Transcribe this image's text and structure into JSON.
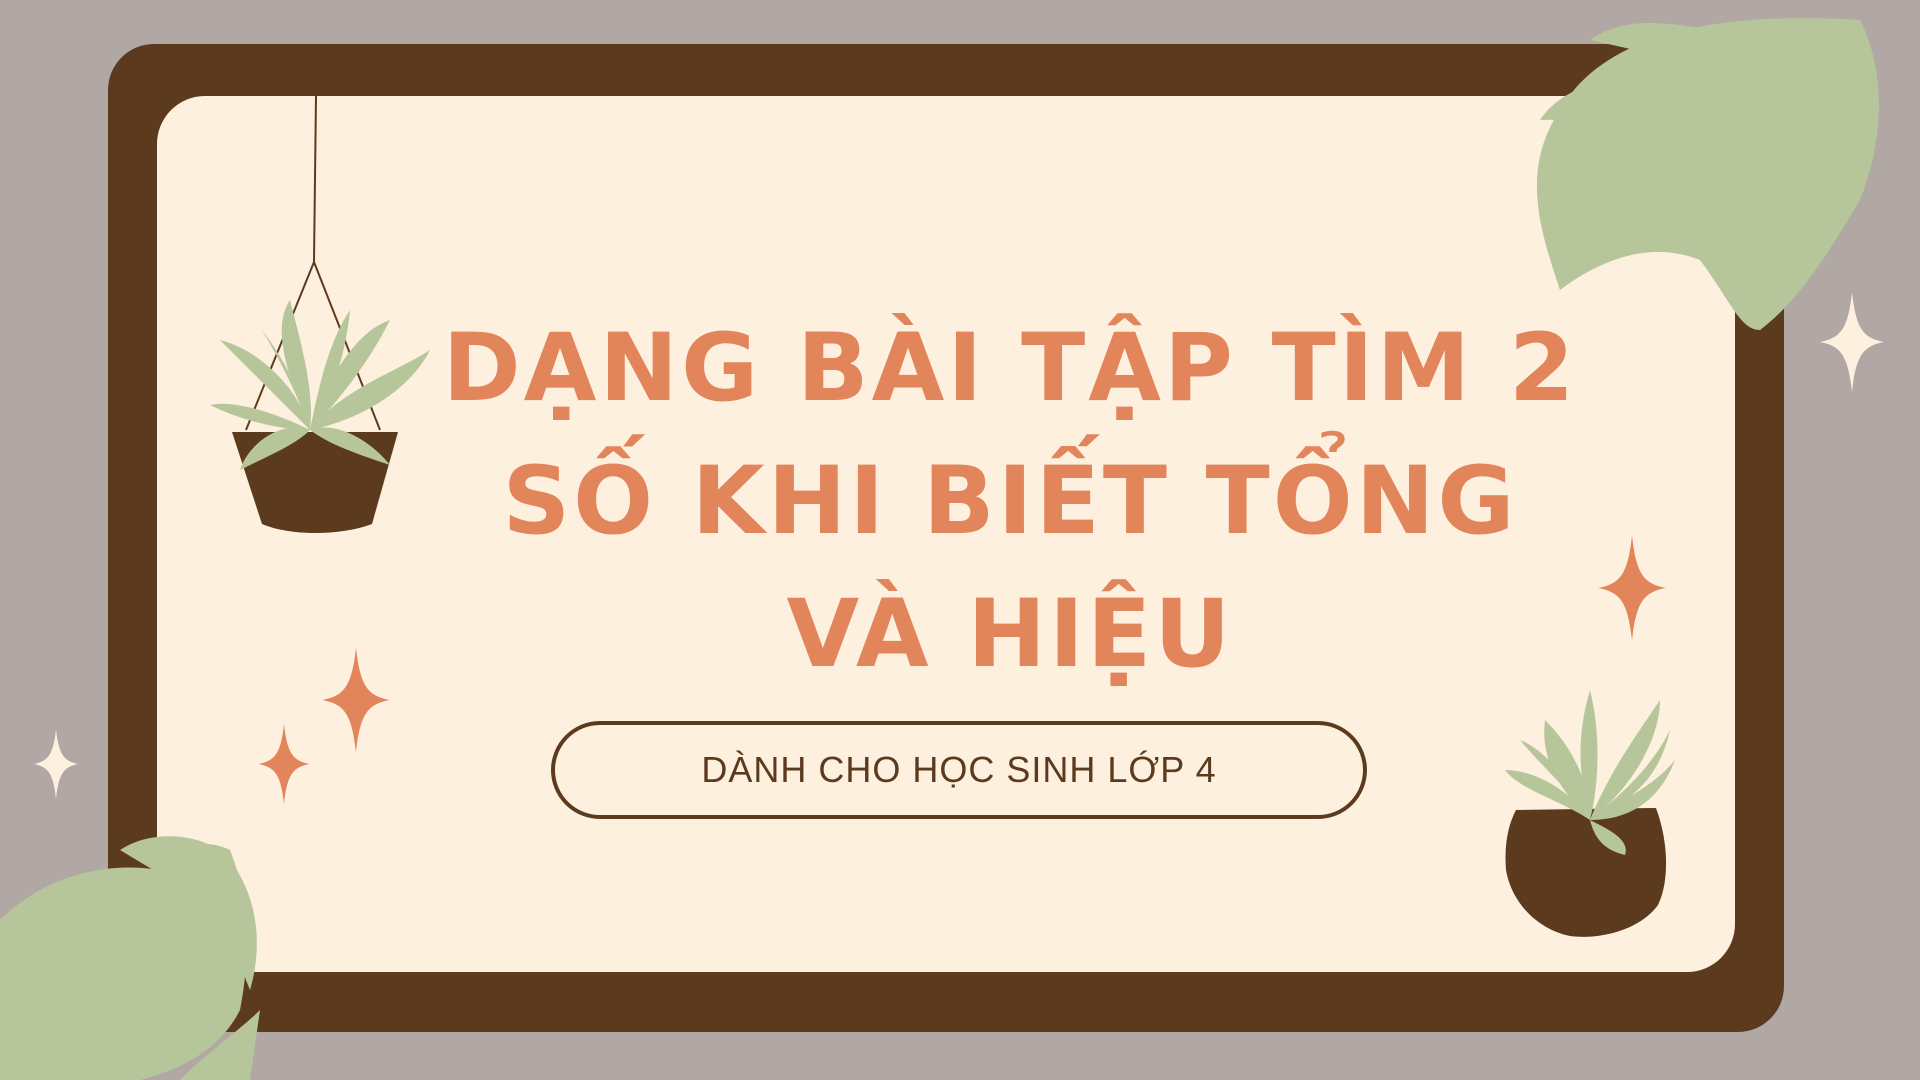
{
  "title": {
    "line1": "DẠNG BÀI TẬP TÌM 2",
    "line2": "SỐ KHI BIẾT TỔNG",
    "line3": "VÀ HIỆU"
  },
  "subtitle": "DÀNH CHO HỌC SINH LỚP 4",
  "colors": {
    "background": "#b1a7a4",
    "frame": "#5c3a1e",
    "card": "#fdf0df",
    "title": "#e2855b",
    "leaf": "#b7c69a",
    "sparkle_white": "#fdf0df"
  },
  "decorations": [
    "monstera-leaf-icon",
    "hanging-plant-icon",
    "potted-plant-icon",
    "sparkle-icon"
  ]
}
